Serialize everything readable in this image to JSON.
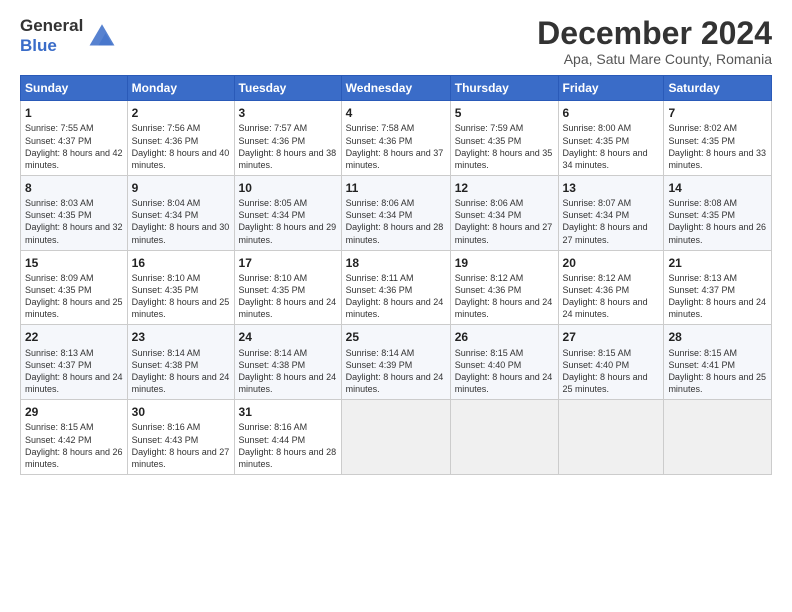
{
  "logo": {
    "line1": "General",
    "line2": "Blue"
  },
  "title": "December 2024",
  "location": "Apa, Satu Mare County, Romania",
  "headers": [
    "Sunday",
    "Monday",
    "Tuesday",
    "Wednesday",
    "Thursday",
    "Friday",
    "Saturday"
  ],
  "weeks": [
    [
      {
        "day": "1",
        "sunrise": "7:55 AM",
        "sunset": "4:37 PM",
        "daylight": "8 hours and 42 minutes."
      },
      {
        "day": "2",
        "sunrise": "7:56 AM",
        "sunset": "4:36 PM",
        "daylight": "8 hours and 40 minutes."
      },
      {
        "day": "3",
        "sunrise": "7:57 AM",
        "sunset": "4:36 PM",
        "daylight": "8 hours and 38 minutes."
      },
      {
        "day": "4",
        "sunrise": "7:58 AM",
        "sunset": "4:36 PM",
        "daylight": "8 hours and 37 minutes."
      },
      {
        "day": "5",
        "sunrise": "7:59 AM",
        "sunset": "4:35 PM",
        "daylight": "8 hours and 35 minutes."
      },
      {
        "day": "6",
        "sunrise": "8:00 AM",
        "sunset": "4:35 PM",
        "daylight": "8 hours and 34 minutes."
      },
      {
        "day": "7",
        "sunrise": "8:02 AM",
        "sunset": "4:35 PM",
        "daylight": "8 hours and 33 minutes."
      }
    ],
    [
      {
        "day": "8",
        "sunrise": "8:03 AM",
        "sunset": "4:35 PM",
        "daylight": "8 hours and 32 minutes."
      },
      {
        "day": "9",
        "sunrise": "8:04 AM",
        "sunset": "4:34 PM",
        "daylight": "8 hours and 30 minutes."
      },
      {
        "day": "10",
        "sunrise": "8:05 AM",
        "sunset": "4:34 PM",
        "daylight": "8 hours and 29 minutes."
      },
      {
        "day": "11",
        "sunrise": "8:06 AM",
        "sunset": "4:34 PM",
        "daylight": "8 hours and 28 minutes."
      },
      {
        "day": "12",
        "sunrise": "8:06 AM",
        "sunset": "4:34 PM",
        "daylight": "8 hours and 27 minutes."
      },
      {
        "day": "13",
        "sunrise": "8:07 AM",
        "sunset": "4:34 PM",
        "daylight": "8 hours and 27 minutes."
      },
      {
        "day": "14",
        "sunrise": "8:08 AM",
        "sunset": "4:35 PM",
        "daylight": "8 hours and 26 minutes."
      }
    ],
    [
      {
        "day": "15",
        "sunrise": "8:09 AM",
        "sunset": "4:35 PM",
        "daylight": "8 hours and 25 minutes."
      },
      {
        "day": "16",
        "sunrise": "8:10 AM",
        "sunset": "4:35 PM",
        "daylight": "8 hours and 25 minutes."
      },
      {
        "day": "17",
        "sunrise": "8:10 AM",
        "sunset": "4:35 PM",
        "daylight": "8 hours and 24 minutes."
      },
      {
        "day": "18",
        "sunrise": "8:11 AM",
        "sunset": "4:36 PM",
        "daylight": "8 hours and 24 minutes."
      },
      {
        "day": "19",
        "sunrise": "8:12 AM",
        "sunset": "4:36 PM",
        "daylight": "8 hours and 24 minutes."
      },
      {
        "day": "20",
        "sunrise": "8:12 AM",
        "sunset": "4:36 PM",
        "daylight": "8 hours and 24 minutes."
      },
      {
        "day": "21",
        "sunrise": "8:13 AM",
        "sunset": "4:37 PM",
        "daylight": "8 hours and 24 minutes."
      }
    ],
    [
      {
        "day": "22",
        "sunrise": "8:13 AM",
        "sunset": "4:37 PM",
        "daylight": "8 hours and 24 minutes."
      },
      {
        "day": "23",
        "sunrise": "8:14 AM",
        "sunset": "4:38 PM",
        "daylight": "8 hours and 24 minutes."
      },
      {
        "day": "24",
        "sunrise": "8:14 AM",
        "sunset": "4:38 PM",
        "daylight": "8 hours and 24 minutes."
      },
      {
        "day": "25",
        "sunrise": "8:14 AM",
        "sunset": "4:39 PM",
        "daylight": "8 hours and 24 minutes."
      },
      {
        "day": "26",
        "sunrise": "8:15 AM",
        "sunset": "4:40 PM",
        "daylight": "8 hours and 24 minutes."
      },
      {
        "day": "27",
        "sunrise": "8:15 AM",
        "sunset": "4:40 PM",
        "daylight": "8 hours and 25 minutes."
      },
      {
        "day": "28",
        "sunrise": "8:15 AM",
        "sunset": "4:41 PM",
        "daylight": "8 hours and 25 minutes."
      }
    ],
    [
      {
        "day": "29",
        "sunrise": "8:15 AM",
        "sunset": "4:42 PM",
        "daylight": "8 hours and 26 minutes."
      },
      {
        "day": "30",
        "sunrise": "8:16 AM",
        "sunset": "4:43 PM",
        "daylight": "8 hours and 27 minutes."
      },
      {
        "day": "31",
        "sunrise": "8:16 AM",
        "sunset": "4:44 PM",
        "daylight": "8 hours and 28 minutes."
      },
      null,
      null,
      null,
      null
    ]
  ],
  "labels": {
    "sunrise": "Sunrise:",
    "sunset": "Sunset:",
    "daylight": "Daylight:"
  }
}
